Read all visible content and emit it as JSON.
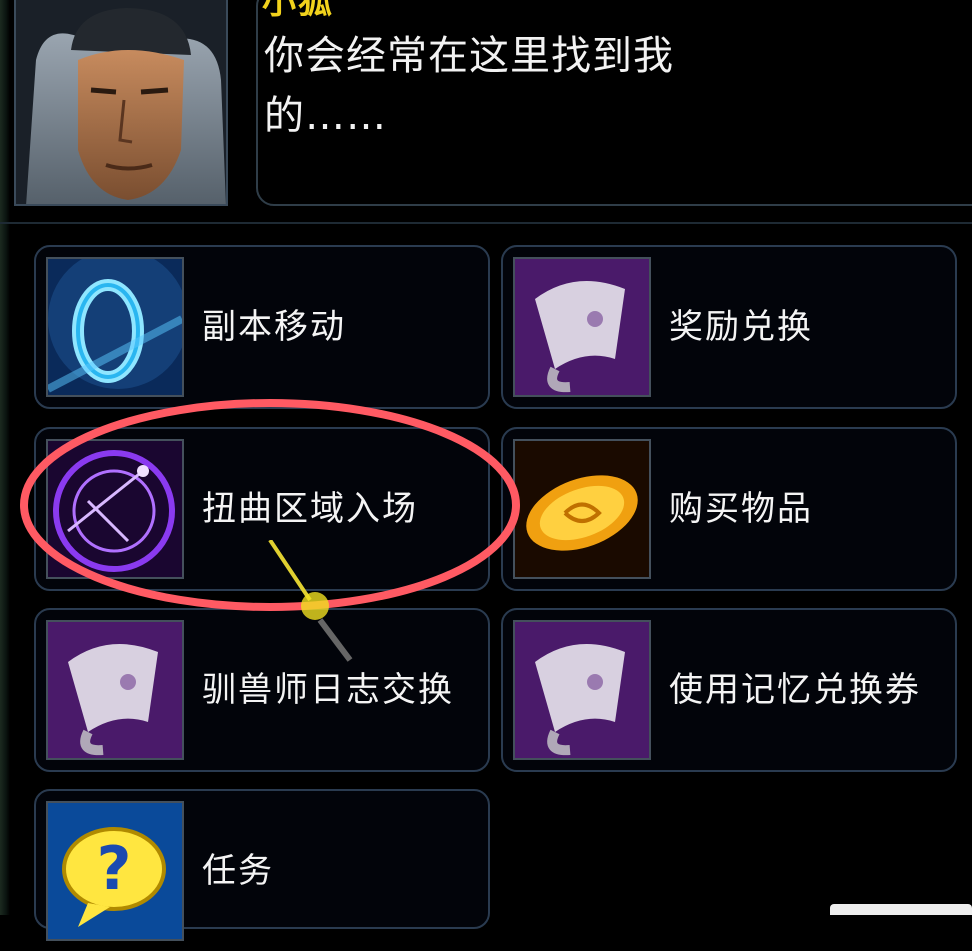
{
  "npc": {
    "name": "小狐",
    "dialogue": "你会经常在这里找到我的……"
  },
  "menu": [
    {
      "label": "副本移动",
      "icon": "blue-ring-portal-icon"
    },
    {
      "label": "奖励兑换",
      "icon": "scroll-icon"
    },
    {
      "label": "扭曲区域入场",
      "icon": "purple-magic-circle-icon",
      "highlighted": true
    },
    {
      "label": "购买物品",
      "icon": "gold-coin-icon"
    },
    {
      "label": "驯兽师日志交换",
      "icon": "scroll-icon"
    },
    {
      "label": "使用记忆兑换券",
      "icon": "scroll-icon"
    },
    {
      "label": "任务",
      "icon": "question-bubble-icon"
    }
  ],
  "colors": {
    "highlight": "#ff5a63",
    "name": "#f2d21c",
    "border": "#2a3b50"
  }
}
